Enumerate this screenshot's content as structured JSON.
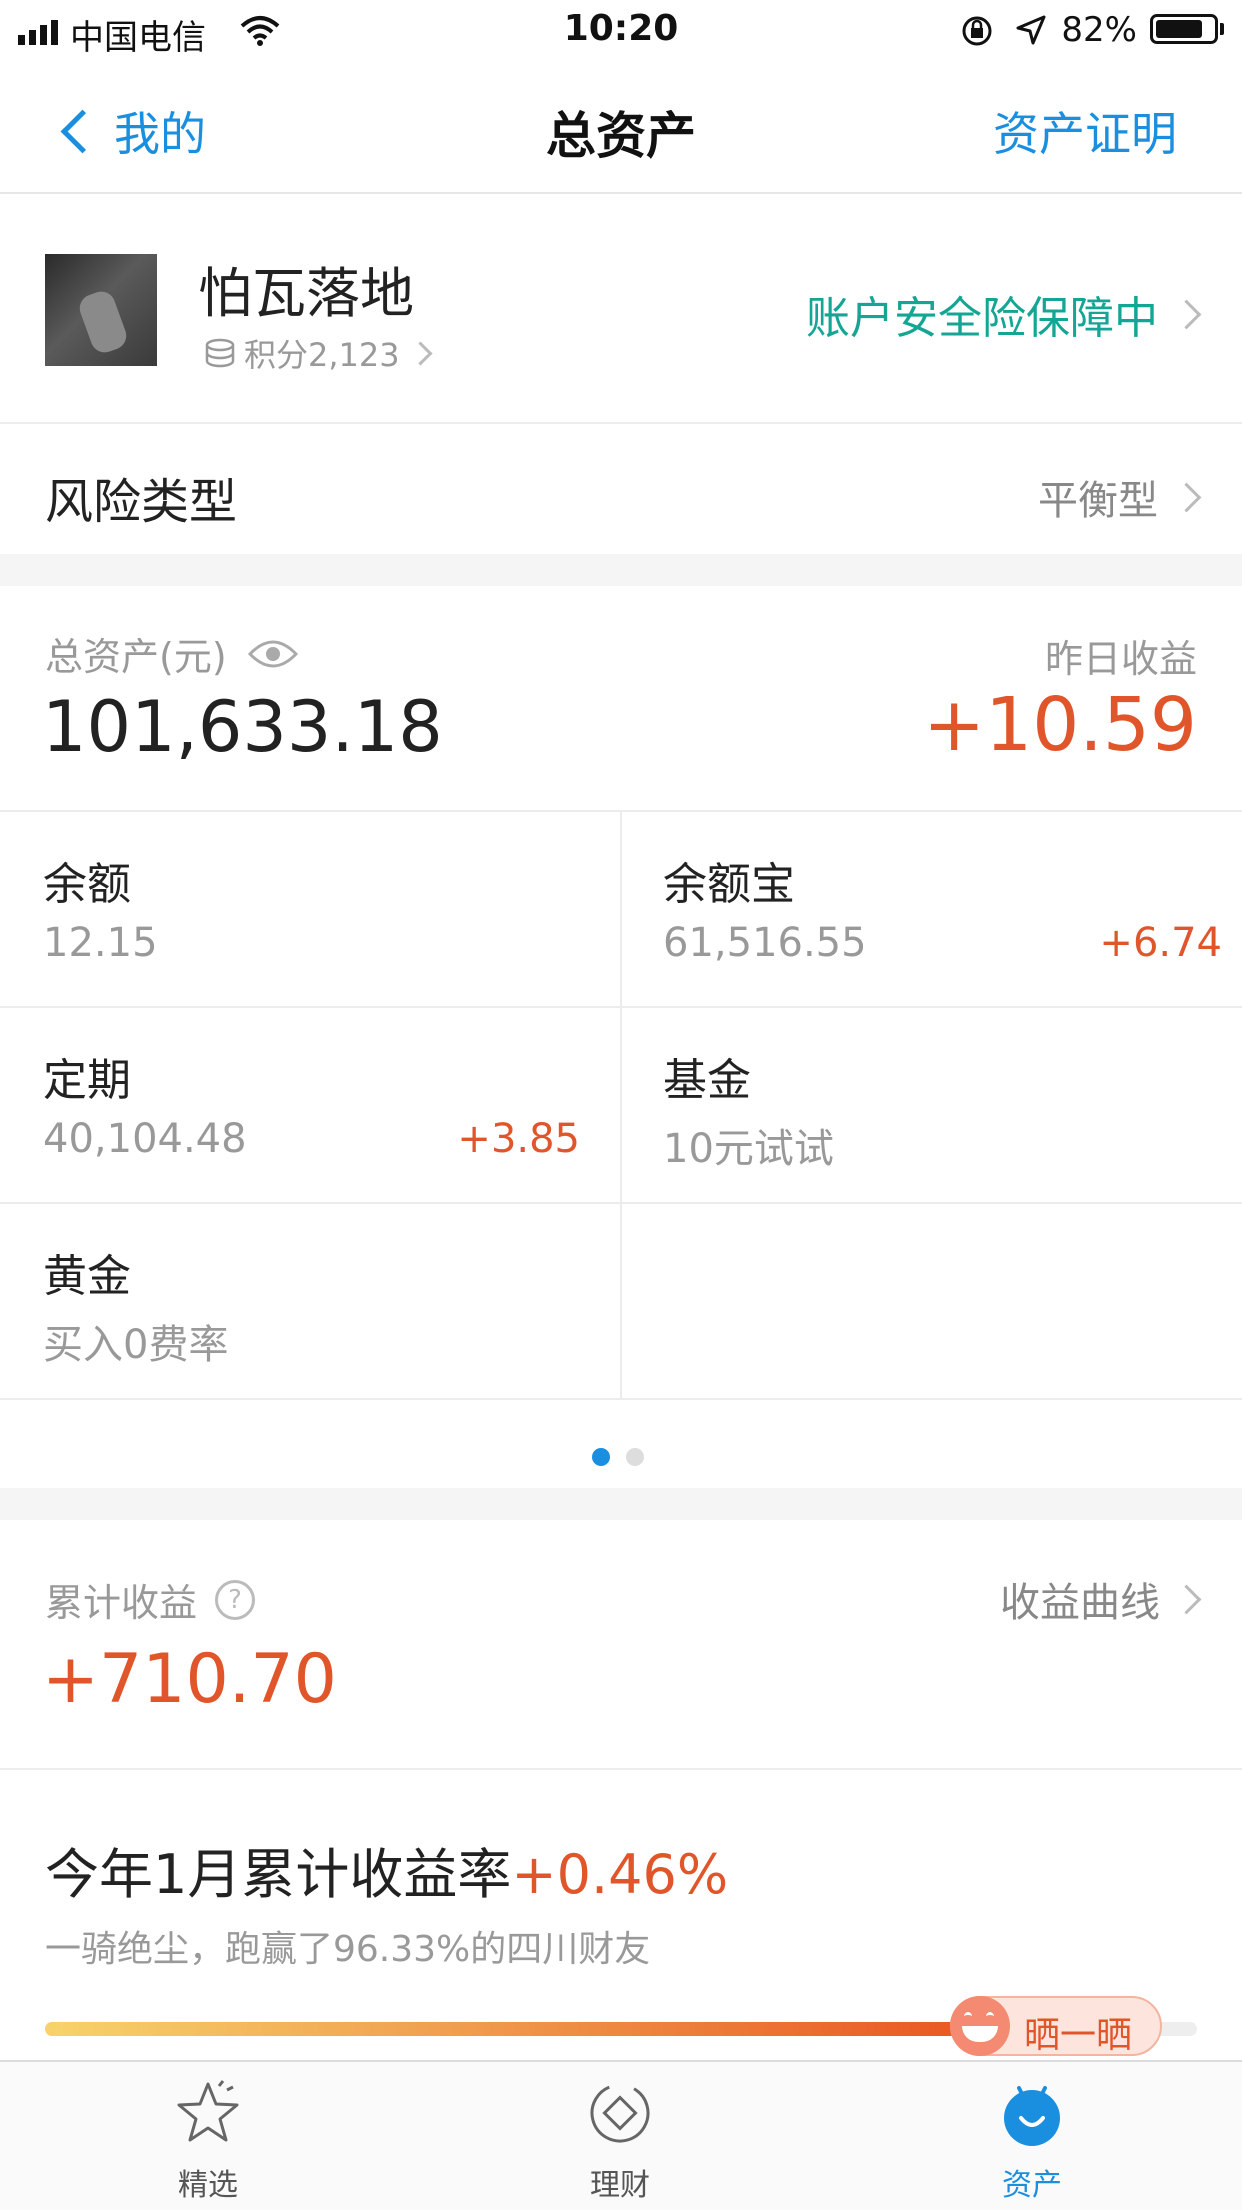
{
  "status_bar": {
    "carrier": "中国电信",
    "time": "10:20",
    "battery_percent": "82%",
    "battery_level": 0.82
  },
  "nav": {
    "back_label": "我的",
    "title": "总资产",
    "right_action": "资产证明"
  },
  "profile": {
    "name": "怕瓦落地",
    "points": "积分2,123",
    "insurance": "账户安全险保障中"
  },
  "risk": {
    "label": "风险类型",
    "value": "平衡型"
  },
  "assets": {
    "total_label": "总资产(元)",
    "total_value": "101,633.18",
    "yesterday_label": "昨日收益",
    "yesterday_value": "+10.59"
  },
  "cells": [
    {
      "title": "余额",
      "value": "12.15",
      "increment": ""
    },
    {
      "title": "余额宝",
      "value": "61,516.55",
      "increment": "+6.74"
    },
    {
      "title": "定期",
      "value": "40,104.48",
      "increment": "+3.85"
    },
    {
      "title": "基金",
      "value": "10元试试",
      "increment": ""
    },
    {
      "title": "黄金",
      "value": "买入0费率",
      "increment": ""
    }
  ],
  "pager": {
    "pages": 2,
    "active": 0
  },
  "cumulative": {
    "label": "累计收益",
    "curve_link": "收益曲线",
    "value": "+710.70"
  },
  "rate": {
    "title": "今年1月累计收益率",
    "value": "+0.46%",
    "subtitle": "一骑绝尘，跑赢了96.33%的四川财友",
    "progress": 0.9633,
    "share_label": "晒一晒"
  },
  "tabbar": {
    "items": [
      {
        "label": "精选",
        "icon": "star-icon",
        "active": false
      },
      {
        "label": "理财",
        "icon": "finance-icon",
        "active": false
      },
      {
        "label": "资产",
        "icon": "assets-icon",
        "active": true
      }
    ]
  },
  "colors": {
    "accent_blue": "#1a8fe0",
    "teal": "#14a594",
    "orange": "#e0562a"
  }
}
